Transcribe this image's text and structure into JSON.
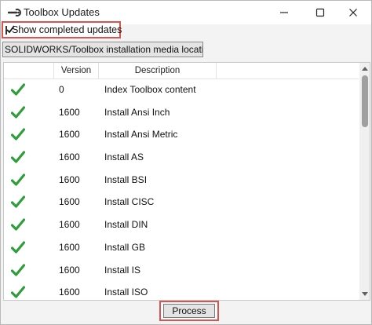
{
  "window": {
    "title": "Toolbox Updates"
  },
  "options": {
    "show_completed_label": "Show completed updates",
    "show_completed_checked": true
  },
  "location_button": {
    "label": "SOLIDWORKS/Toolbox installation media location..."
  },
  "list": {
    "columns": [
      "",
      "Version",
      "Description"
    ],
    "rows": [
      {
        "status": "check-icon",
        "version": "0",
        "description": "Index Toolbox content"
      },
      {
        "status": "check-icon",
        "version": "1600",
        "description": "Install Ansi Inch"
      },
      {
        "status": "check-icon",
        "version": "1600",
        "description": "Install Ansi Metric"
      },
      {
        "status": "check-icon",
        "version": "1600",
        "description": "Install AS"
      },
      {
        "status": "check-icon",
        "version": "1600",
        "description": "Install BSI"
      },
      {
        "status": "check-icon",
        "version": "1600",
        "description": "Install CISC"
      },
      {
        "status": "check-icon",
        "version": "1600",
        "description": "Install DIN"
      },
      {
        "status": "check-icon",
        "version": "1600",
        "description": "Install GB"
      },
      {
        "status": "check-icon",
        "version": "1600",
        "description": "Install IS"
      },
      {
        "status": "check-icon",
        "version": "1600",
        "description": "Install ISO"
      }
    ]
  },
  "footer": {
    "process_label": "Process"
  },
  "colors": {
    "highlight_border": "#d9534f",
    "check_green": "#2e9e3a"
  }
}
